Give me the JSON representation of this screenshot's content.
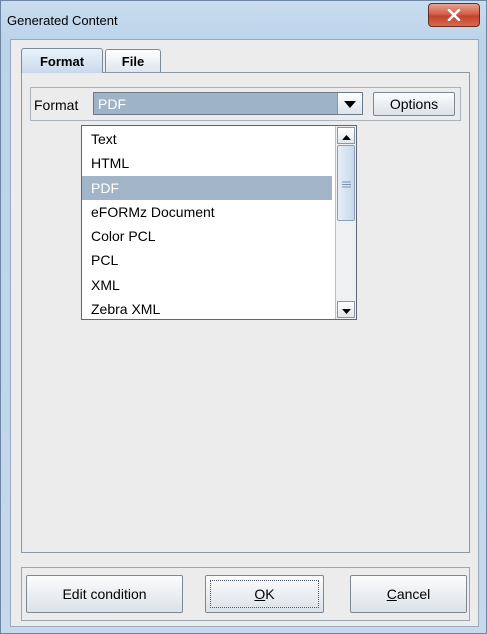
{
  "window": {
    "title": "Generated Content",
    "close_icon": "close-x-icon"
  },
  "tabs": [
    {
      "label": "Format",
      "active": true
    },
    {
      "label": "File",
      "active": false
    }
  ],
  "format": {
    "label": "Format",
    "selected_value": "PDF",
    "options_button": "Options"
  },
  "dropdown": {
    "items": [
      {
        "label": "Text"
      },
      {
        "label": "HTML"
      },
      {
        "label": "PDF"
      },
      {
        "label": "eFORMz Document"
      },
      {
        "label": "Color PCL"
      },
      {
        "label": "PCL"
      },
      {
        "label": "XML"
      },
      {
        "label": "Zebra XML"
      }
    ],
    "selected_index": 2
  },
  "buttons": {
    "edit_condition": "Edit condition",
    "ok_mnemonic": "O",
    "ok_rest": "K",
    "cancel_mnemonic": "C",
    "cancel_rest": "ancel"
  },
  "colors": {
    "selection": "#a2b4c7",
    "close_button": "#c0432e"
  }
}
